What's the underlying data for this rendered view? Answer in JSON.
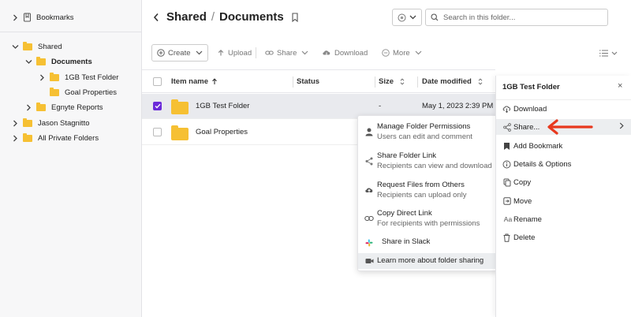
{
  "sidebar": {
    "bookmarks_label": "Bookmarks",
    "tree": [
      {
        "label": "Shared",
        "level": 0,
        "expanded": true,
        "bold": false
      },
      {
        "label": "Documents",
        "level": 1,
        "expanded": true,
        "bold": true
      },
      {
        "label": "1GB Test Folder",
        "level": 2,
        "expanded": false,
        "bold": false
      },
      {
        "label": "Goal Properties",
        "level": 2,
        "expanded": null,
        "bold": false
      },
      {
        "label": "Egnyte Reports",
        "level": 1,
        "expanded": false,
        "bold": false
      },
      {
        "label": "Jason Stagnitto",
        "level": 0,
        "expanded": false,
        "bold": false
      },
      {
        "label": "All Private Folders",
        "level": 0,
        "expanded": false,
        "bold": false
      }
    ]
  },
  "header": {
    "breadcrumb_parent": "Shared",
    "breadcrumb_sep": "/",
    "breadcrumb_current": "Documents",
    "search_placeholder": "Search in this folder..."
  },
  "toolbar": {
    "create": "Create",
    "upload": "Upload",
    "share": "Share",
    "download": "Download",
    "more": "More"
  },
  "table": {
    "columns": {
      "name": "Item name",
      "status": "Status",
      "size": "Size",
      "date": "Date modified"
    },
    "rows": [
      {
        "name": "1GB Test Folder",
        "status": "",
        "size": "-",
        "date": "May 1, 2023 2:39 PM",
        "selected": true
      },
      {
        "name": "Goal Properties",
        "status": "",
        "size": "",
        "date": "",
        "selected": false
      }
    ]
  },
  "share_menu": {
    "items": [
      {
        "title": "Manage Folder Permissions",
        "subtitle": "Users can edit and comment",
        "icon": "user-icon"
      },
      {
        "title": "Share Folder Link",
        "subtitle": "Recipients can view and download",
        "icon": "share-icon"
      },
      {
        "title": "Request Files from Others",
        "subtitle": "Recipients can upload only",
        "icon": "cloud-upload-icon"
      },
      {
        "title": "Copy Direct Link",
        "subtitle": "For recipients with permissions",
        "icon": "link-icon"
      },
      {
        "title": "Share in Slack",
        "subtitle": "",
        "icon": "slack-icon"
      },
      {
        "title": "Learn more about folder sharing",
        "subtitle": "",
        "icon": "video-icon"
      }
    ]
  },
  "panel": {
    "title": "1GB Test Folder",
    "close": "×",
    "actions": [
      {
        "label": "Download",
        "icon": "cloud-download-icon"
      },
      {
        "label": "Share...",
        "icon": "share-icon",
        "highlighted": true
      },
      {
        "label": "Add Bookmark",
        "icon": "bookmark-icon"
      },
      {
        "label": "Details & Options",
        "icon": "info-icon"
      },
      {
        "label": "Copy",
        "icon": "copy-icon"
      },
      {
        "label": "Move",
        "icon": "move-icon"
      },
      {
        "label": "Rename",
        "icon": "rename-icon"
      },
      {
        "label": "Delete",
        "icon": "trash-icon"
      }
    ]
  },
  "colors": {
    "accent": "#6c2bd9",
    "folder": "#f6c033",
    "annotation_arrow": "#e8391e"
  }
}
